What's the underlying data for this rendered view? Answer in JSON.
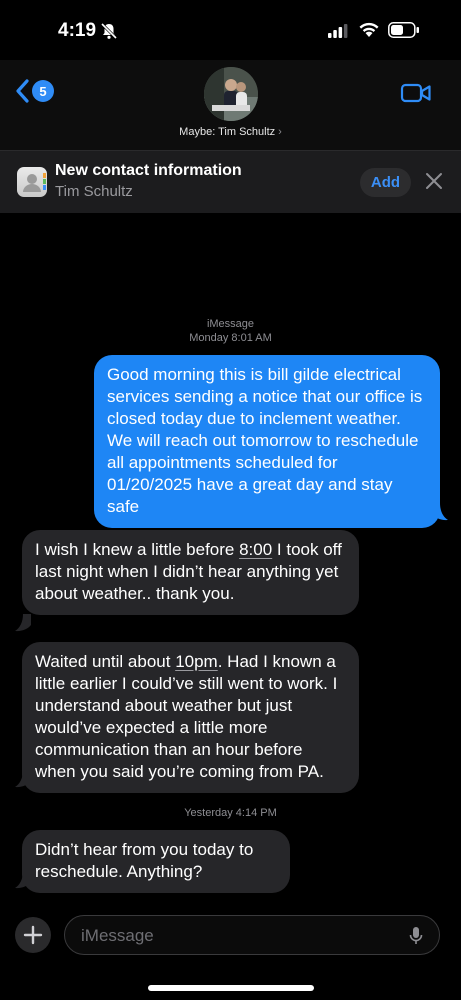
{
  "status_bar": {
    "time": "4:19",
    "icons": [
      "bell-slash-icon",
      "cellular-signal-icon",
      "wifi-icon",
      "battery-icon"
    ]
  },
  "header": {
    "back_badge_count": "5",
    "contact_name": "Maybe: Tim Schultz",
    "contact_chevron": "›",
    "accent_color": "#2f8cf6"
  },
  "banner": {
    "title": "New contact information",
    "subtitle": "Tim Schultz",
    "add_label": "Add"
  },
  "thread": {
    "service_label": "iMessage",
    "stamp1": "Monday 8:01 AM",
    "stamp2": "Yesterday 4:14 PM",
    "messages": [
      {
        "direction": "sent",
        "text": "Good morning this is bill gilde electrical services sending a notice that our office is closed today due to inclement weather. We will reach out tomorrow to reschedule all appointments scheduled for 01/20/2025 have a great day and stay safe"
      },
      {
        "direction": "received",
        "text": "I wish I knew a little before 8:00 I took off last night when I didn’t hear anything yet about weather.. thank you.",
        "underlined": "8:00"
      },
      {
        "direction": "received",
        "text": "Waited until about 10pm. Had I known a little earlier I could’ve still went to work. I understand about weather but just would’ve expected a little more communication than an hour before when you said you’re coming from PA.",
        "underlined": "10pm"
      },
      {
        "direction": "received",
        "text": "Didn’t hear from you today to reschedule. Anything?"
      }
    ]
  },
  "composer": {
    "placeholder": "iMessage"
  },
  "colors": {
    "sent_bubble": "#1e86f5",
    "received_bubble": "#262629",
    "background": "#000000"
  }
}
